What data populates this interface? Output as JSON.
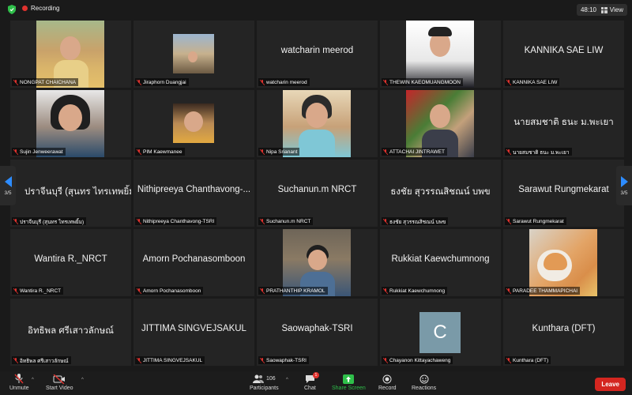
{
  "topbar": {
    "recording_label": "Recording",
    "timer": "48:10",
    "view_label": "View"
  },
  "navigation": {
    "page_indicator": "3/5"
  },
  "participants": [
    {
      "display": "",
      "label": "NONGPAT CHAICHANA"
    },
    {
      "display": "",
      "label": "Jiraphorn Duangjai"
    },
    {
      "display": "watcharin meerod",
      "label": "watcharin meerod"
    },
    {
      "display": "",
      "label": "THEWIN KAEOMUANGMOON"
    },
    {
      "display": "KANNIKA SAE LIW",
      "label": "KANNIKA SAE LIW"
    },
    {
      "display": "",
      "label": "Sujin Jenweerawat"
    },
    {
      "display": "",
      "label": "PIM Kaewmanee"
    },
    {
      "display": "",
      "label": "Nipa Srianant"
    },
    {
      "display": "",
      "label": "ATTACHAI JINTRAWET"
    },
    {
      "display": "นายสมชาติ ธนะ ม.พะเยา",
      "label": "นายสมชาติ ธนะ ม.พะเยา"
    },
    {
      "display": "ปราจีนบุรี (สุนทร ไทรเทพยิ้ม)",
      "label": "ปราจีนบุรี (สุนทร ไทรเทพยิ้ม)"
    },
    {
      "display": "Nithipreeya Chanthavong-...",
      "label": "Nithipreeya Chanthavong-TSRI"
    },
    {
      "display": "Suchanun.m NRCT",
      "label": "Suchanun.m NRCT"
    },
    {
      "display": "ธงชัย สุวรรณสิชณน์ บพข",
      "label": "ธงชัย สุวรรณสิชณน์ บพข"
    },
    {
      "display": "Sarawut Rungmekarat",
      "label": "Sarawut Rungmekarat"
    },
    {
      "display": "Wantira R._NRCT",
      "label": "Wantira R._NRCT"
    },
    {
      "display": "Amorn Pochanasomboon",
      "label": "Amorn Pochanasomboon"
    },
    {
      "display": "",
      "label": "PRATHANTHIP KRAMOL"
    },
    {
      "display": "Rukkiat Kaewchumnong",
      "label": "Rukkiat Kaewchumnong"
    },
    {
      "display": "",
      "label": "PARADEE THAMMAPICHAI"
    },
    {
      "display": "อิทธิพล ศรีเสาวลักษณ์",
      "label": "อิทธิพล ศรีเสาวลักษณ์"
    },
    {
      "display": "JITTIMA SINGVEJSAKUL",
      "label": "JITTIMA SINGVEJSAKUL"
    },
    {
      "display": "Saowaphak-TSRI",
      "label": "Saowaphak-TSRI"
    },
    {
      "display": "C",
      "label": "Chayanon Kittayachaweng"
    },
    {
      "display": "Kunthara (DFT)",
      "label": "Kunthara (DFT)"
    }
  ],
  "toolbar": {
    "unmute": "Unmute",
    "start_video": "Start Video",
    "participants": "Participants",
    "participants_count": "106",
    "chat": "Chat",
    "chat_badge": "1",
    "share_screen": "Share Screen",
    "record": "Record",
    "reactions": "Reactions",
    "leave": "Leave"
  },
  "colors": {
    "accent": "#2d8cff",
    "record_red": "#e0322e",
    "share_green": "#2fbf4a",
    "leave_red": "#d42620"
  }
}
